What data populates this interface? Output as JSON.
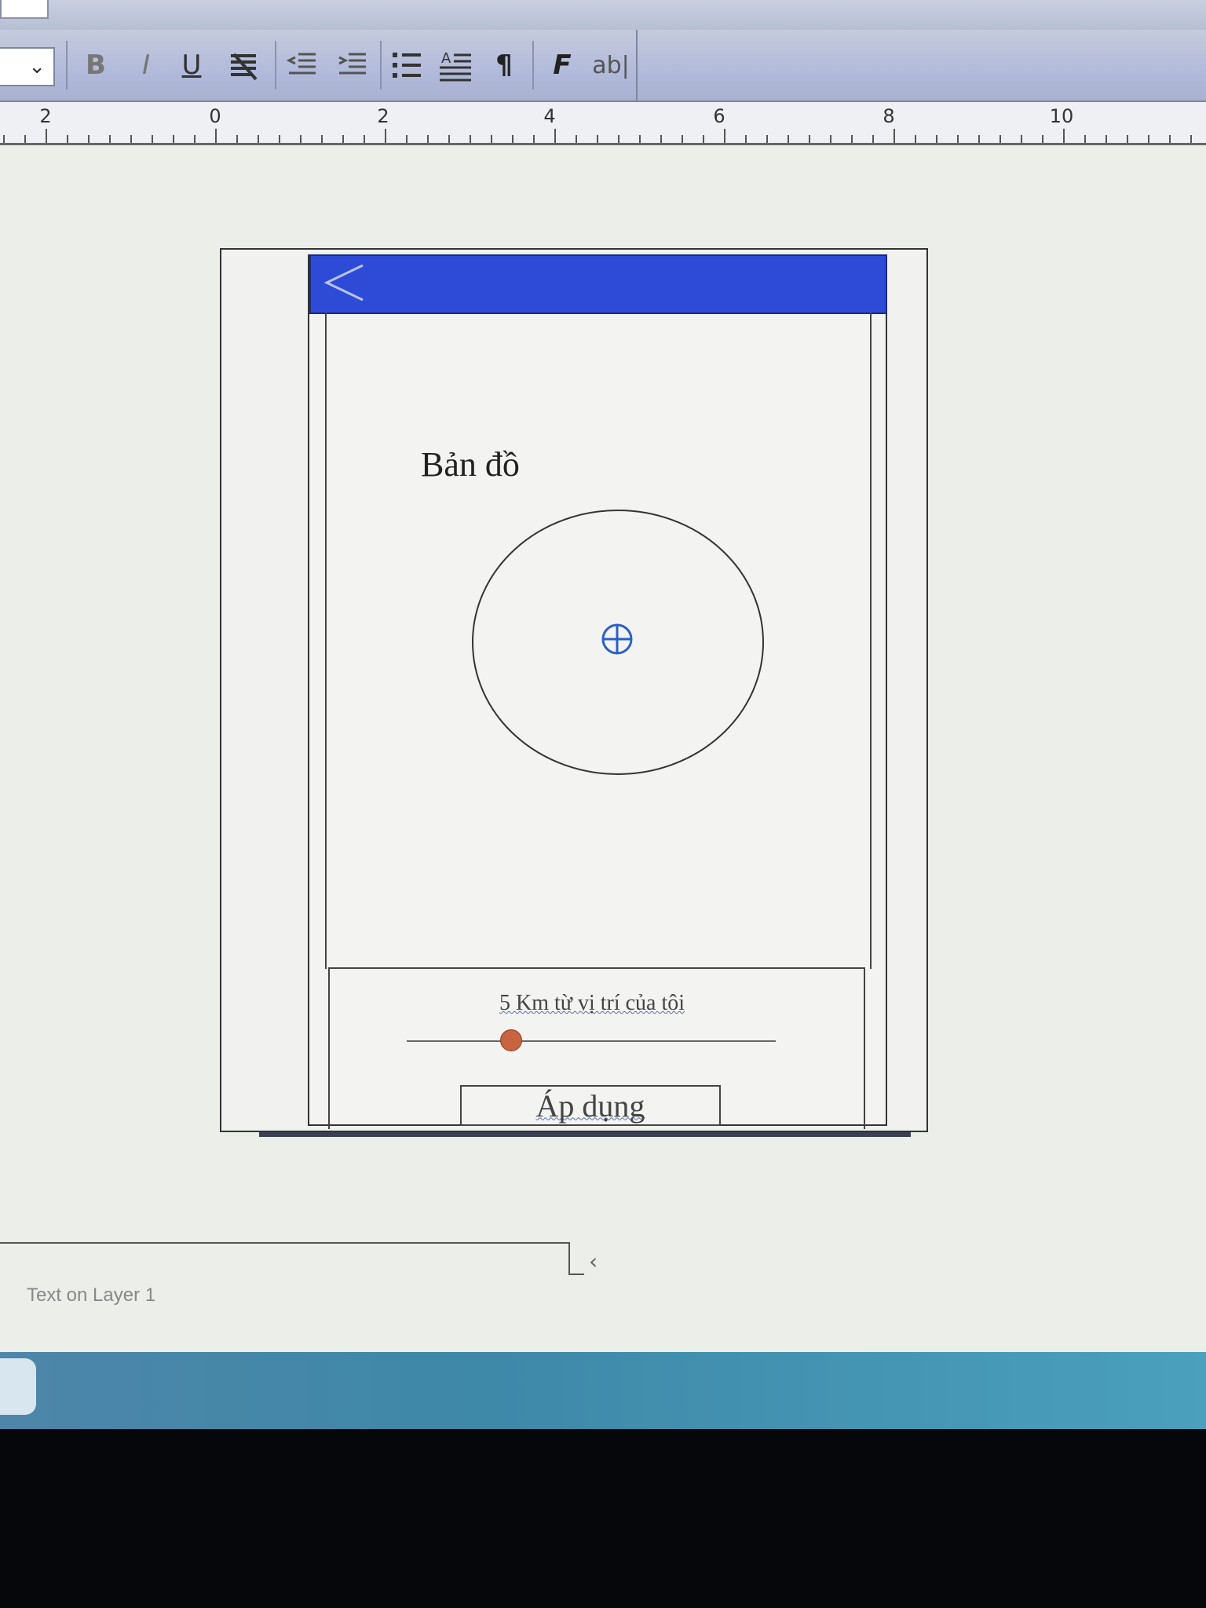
{
  "toolbar": {
    "bold": "B",
    "italic": "I",
    "underline": "U",
    "pilcrow": "¶",
    "font_effect": "F",
    "text_tool": "ab|"
  },
  "ruler": {
    "labels": [
      "2",
      "0",
      "2",
      "4",
      "6",
      "8",
      "10"
    ]
  },
  "app": {
    "header_color": "#2d4bd6",
    "back_icon": "chevron-left-icon",
    "map_title": "Bản đồ",
    "location_icon": "crosshair-icon",
    "radius_label": "5 Km từ vị trí của tôi",
    "slider_value_fraction": 0.28,
    "slider_thumb_color": "#c8643f",
    "apply_button": "Áp dụng"
  },
  "status": {
    "layer_text": "Text on Layer 1"
  }
}
